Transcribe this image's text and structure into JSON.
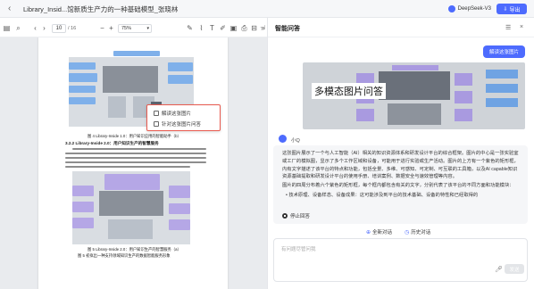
{
  "window": {
    "title": "Library_Insid...馆新质生产力的一种基础模型_张晓林",
    "model_name": "DeepSeek-V3",
    "export_label": "导出"
  },
  "pdf_toolbar": {
    "page_current": "10",
    "page_total": "/ 16",
    "zoom": "75%"
  },
  "pdf_page": {
    "caption1": "图 4   Library-Inside 1.0：用户知识应用的智能助手（b）",
    "heading1": "3.2.2 Library-Inside 2.0：用户知识生产的智慧服务",
    "caption2": "图 5   Library-Inside 2.0：用户知识生产的智慧服务（a）",
    "caption3": "图 5 初拟出一种支持领域知识生产的数据智能服务形象"
  },
  "context_menu": {
    "items": [
      {
        "label": "解读这张图片"
      },
      {
        "label": "针对这张图片问答"
      }
    ]
  },
  "chat": {
    "title": "智能问答",
    "user_message": "解读这张图片",
    "overlay_text": "多模态图片问答",
    "assistant_name": "小Q",
    "paragraph1": "这张图片展示了一个与人工智能（AI）相关的知识资源体系和研发设计平台的综合框架。图片的中心是一张实验室或工厂的模拟图，显示了多个工作区域和设备，可能用于进行实验或生产活动。图片的上方有一个紫色的矩形框，内有文字描述了该平台的特点和功能，包括全景、多维、可感知、可定制、可互联的工具箱，以及AI capable知识资源基础提取和研发设计平台的使用手册、培训案例、数据安全与速效管理等内容。",
    "paragraph2": "图片的四周分布着六个紫色的矩形框，每个框内都包含有关的文字，分别代表了该平台的不同方面和功能模块：",
    "bullet1": "技术原理、设备样态、设备成果：这可能涉及到平台的技术基础、设备的特性和已经取得的",
    "stop_label": "停止回答",
    "quick_links": [
      "全新对话",
      "历史对话"
    ],
    "input_placeholder": "有问题尽管问我",
    "send_label": "发送"
  }
}
